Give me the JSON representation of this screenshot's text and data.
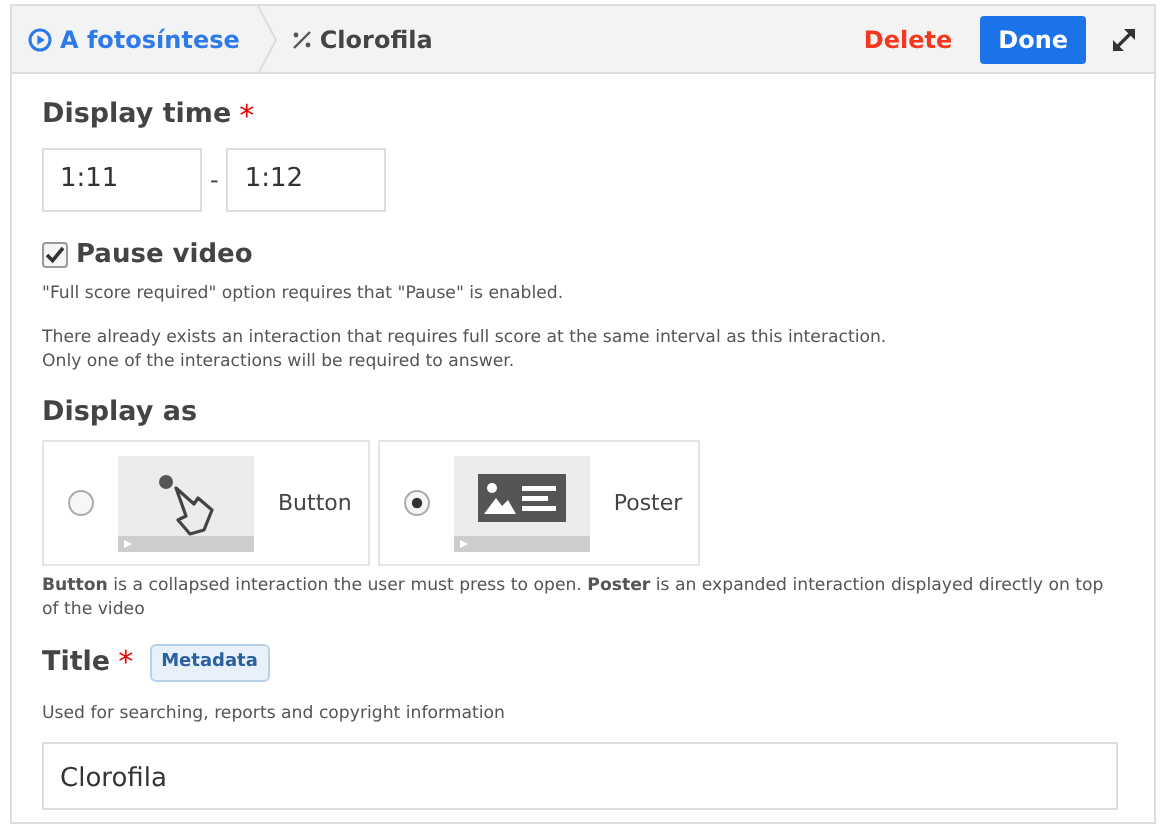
{
  "breadcrumb": {
    "parent": "A fotosíntese",
    "current": "Clorofila"
  },
  "header_actions": {
    "delete": "Delete",
    "done": "Done"
  },
  "display_time": {
    "label": "Display time",
    "required_mark": "*",
    "from": "1:11",
    "separator": "-",
    "to": "1:12"
  },
  "pause_video": {
    "label": "Pause video",
    "checked": true,
    "note": "\"Full score required\" option requires that \"Pause\" is enabled.",
    "warning": [
      "There already exists an interaction that requires full score at the same interval as this interaction.",
      "Only one of the interactions will be required to answer."
    ]
  },
  "display_as": {
    "label": "Display as",
    "options": [
      {
        "kind": "button",
        "label": "Button",
        "selected": false
      },
      {
        "kind": "poster",
        "label": "Poster",
        "selected": true
      }
    ],
    "description": "**Button** is a collapsed interaction the user must press to open. **Poster** is an expanded interaction displayed directly on top of the video"
  },
  "title_field": {
    "label": "Title",
    "required_mark": "*",
    "badge": "Metadata",
    "description": "Used for searching, reports and copyright information",
    "value": "Clorofila"
  }
}
